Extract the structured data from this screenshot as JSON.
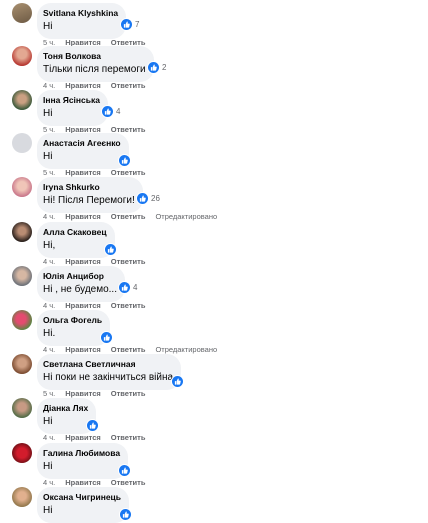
{
  "actions": {
    "like": "Нравится",
    "reply": "Ответить"
  },
  "colors": {
    "bubble": "#f0f2f5",
    "like": "#1877f2",
    "meta": "#65676b"
  },
  "comments": [
    {
      "author": "Svitlana Klyshkina",
      "text": "Ні",
      "time": "5 ч.",
      "reactions": "7",
      "edited": "",
      "avatar": "tan-landscape-photo"
    },
    {
      "author": "Тоня Волкова",
      "text": "Тільки після перемоги",
      "time": "4 ч.",
      "reactions": "2",
      "edited": "",
      "avatar": "woman-red-photo"
    },
    {
      "author": "Інна Ясінська",
      "text": "Ні",
      "time": "5 ч.",
      "reactions": "4",
      "edited": "",
      "avatar": "woman-outdoor-photo"
    },
    {
      "author": "Анастасія Агеєнко",
      "text": "Ні",
      "time": "5 ч.",
      "reactions": "",
      "edited": "",
      "avatar": "default-silhouette"
    },
    {
      "author": "Iryna Shkurko",
      "text": "Ні! Після Перемоги!",
      "time": "4 ч.",
      "reactions": "26",
      "edited": "Отредактировано",
      "avatar": "woman-pink-photo"
    },
    {
      "author": "Алла Скаковец",
      "text": "Ні,",
      "time": "4 ч.",
      "reactions": "",
      "edited": "",
      "avatar": "woman-dark-photo"
    },
    {
      "author": "Юлія Анцибор",
      "text": "Ні , не будемо...",
      "time": "4 ч.",
      "reactions": "4",
      "edited": "",
      "avatar": "woman-grey-photo"
    },
    {
      "author": "Ольга Фогель",
      "text": "Ні.",
      "time": "4 ч.",
      "reactions": "",
      "edited": "Отредактировано",
      "avatar": "flower-photo"
    },
    {
      "author": "Светлана Светличная",
      "text": "Ні поки не закінчиться війна",
      "time": "5 ч.",
      "reactions": "",
      "edited": "",
      "avatar": "woman-brown-photo"
    },
    {
      "author": "Діанка Лях",
      "text": "Ні",
      "time": "4 ч.",
      "reactions": "",
      "edited": "",
      "avatar": "woman-green-photo"
    },
    {
      "author": "Галина Любимова",
      "text": "Ні",
      "time": "4 ч.",
      "reactions": "",
      "edited": "",
      "avatar": "red-flower-photo"
    },
    {
      "author": "Оксана Чигринець",
      "text": "Ні",
      "time": "",
      "reactions": "",
      "edited": "",
      "avatar": "woman-sunny-photo"
    }
  ]
}
